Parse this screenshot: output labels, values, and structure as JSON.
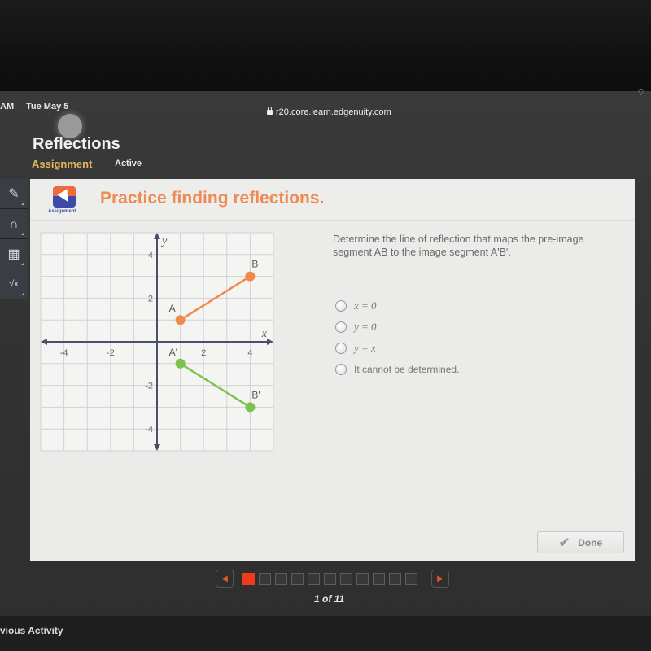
{
  "status_bar": {
    "time": "AM",
    "date": "Tue May 5",
    "url": "r20.core.learn.edgenuity.com",
    "wifi_icon": "wifi-icon",
    "lock_icon": "lock-icon"
  },
  "header": {
    "title": "Reflections",
    "tabs": [
      {
        "label": "Assignment",
        "active": true
      },
      {
        "label": "Active",
        "active": false
      }
    ]
  },
  "toolbar": {
    "tools": [
      {
        "name": "pencil-icon",
        "glyph": "✎"
      },
      {
        "name": "headphones-icon",
        "glyph": "🎧"
      },
      {
        "name": "calculator-icon",
        "glyph": "▦"
      },
      {
        "name": "formula-icon",
        "glyph": "√x"
      }
    ]
  },
  "panel": {
    "badge_label": "Assignment",
    "title": "Practice finding reflections.",
    "question": "Determine the line of reflection that maps the pre-image segment AB to the image segment A'B'.",
    "options": [
      {
        "label": "x = 0",
        "math": true
      },
      {
        "label": "y = 0",
        "math": true
      },
      {
        "label": "y = x",
        "math": true
      },
      {
        "label": "It cannot be determined.",
        "math": false
      }
    ],
    "done_label": "Done"
  },
  "graph": {
    "x_label": "x",
    "y_label": "y",
    "x_range": [
      -5,
      5
    ],
    "y_range": [
      -5,
      5
    ],
    "x_ticks": [
      -4,
      -2,
      2,
      4
    ],
    "y_ticks": [
      4,
      2,
      -2,
      -4
    ],
    "segments": [
      {
        "name": "AB",
        "color": "#f08a4b",
        "points": [
          {
            "label": "A",
            "x": 1,
            "y": 1
          },
          {
            "label": "B",
            "x": 4,
            "y": 3
          }
        ]
      },
      {
        "name": "A'B'",
        "color": "#7cc24f",
        "points": [
          {
            "label": "A'",
            "x": 1,
            "y": -1
          },
          {
            "label": "B'",
            "x": 4,
            "y": -3
          }
        ]
      }
    ]
  },
  "pager": {
    "total": 11,
    "current": 1,
    "count_text": "1 of 11"
  },
  "footer": {
    "previous_activity": "vious Activity"
  }
}
